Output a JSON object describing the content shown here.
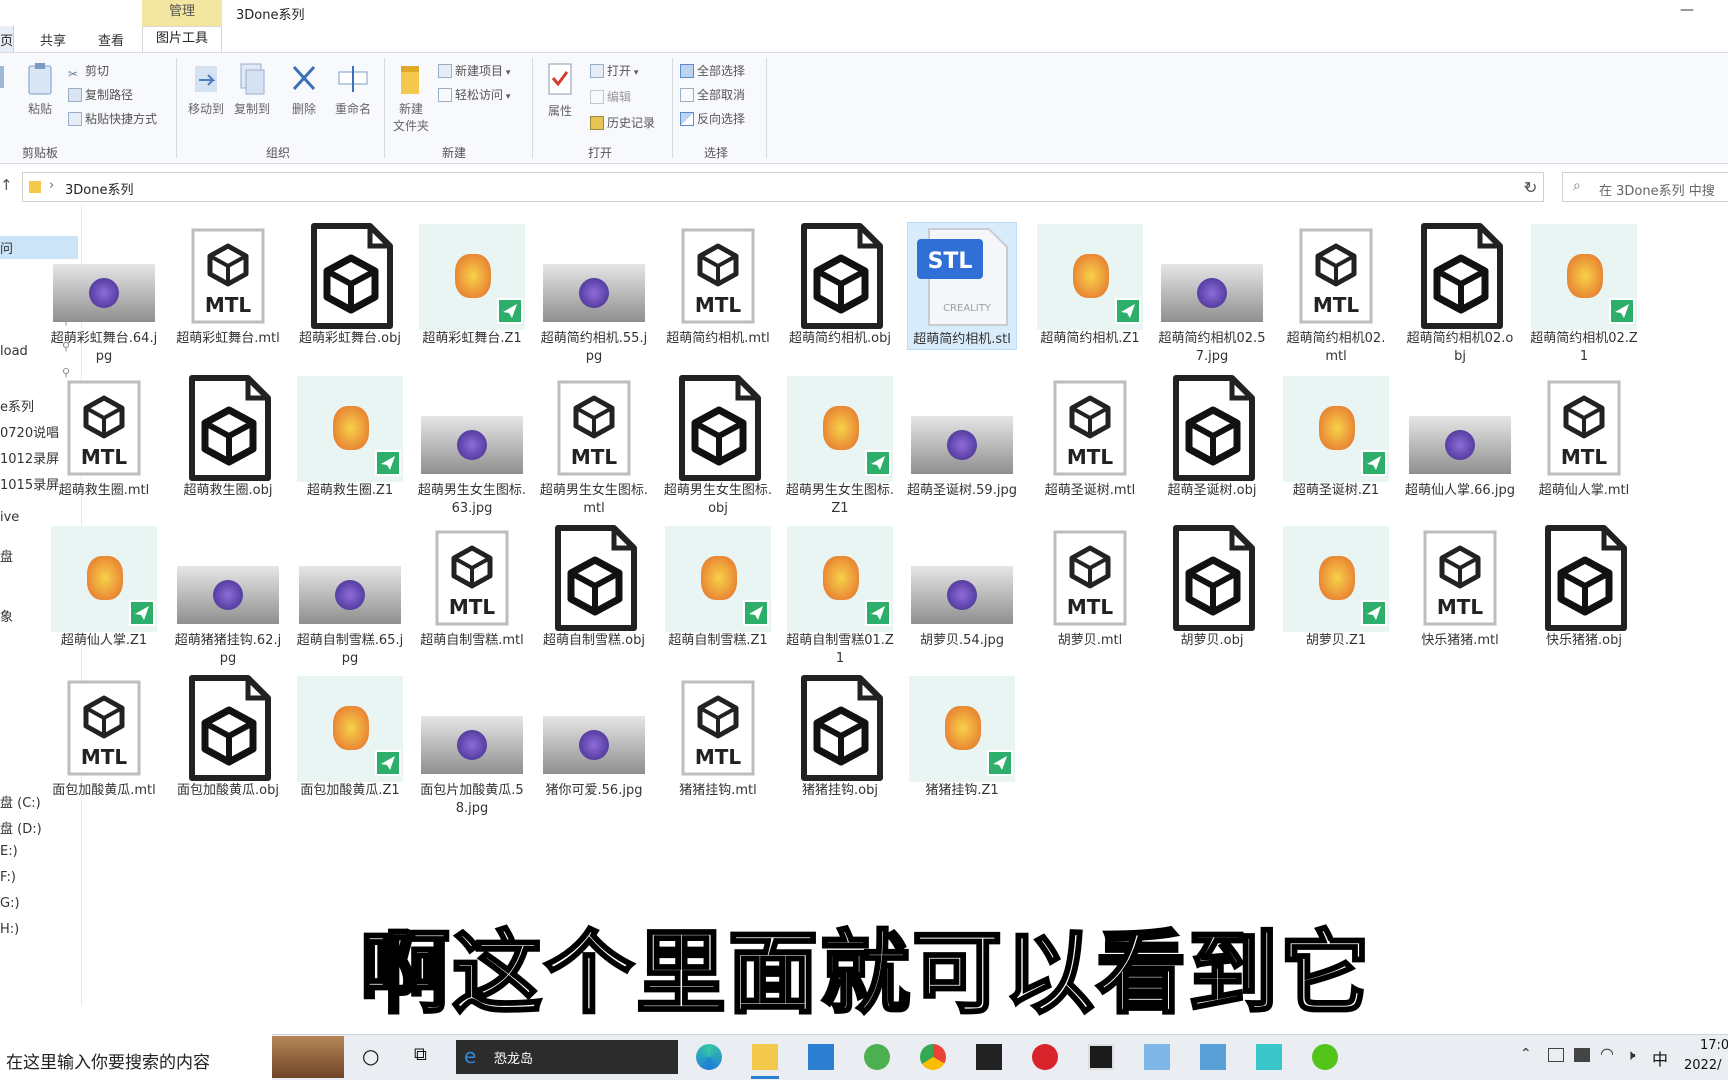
{
  "window": {
    "contextual_tab": "管理",
    "title": "3Done系列",
    "minimize": "—"
  },
  "tabs": [
    "页",
    "共享",
    "查看",
    "图片工具"
  ],
  "ribbon": {
    "clipboard": {
      "label": "剪贴板",
      "paste": "粘贴",
      "cut": "剪切",
      "copy_path": "复制路径",
      "paste_shortcut": "粘贴快捷方式"
    },
    "organize": {
      "label": "组织",
      "move_to": "移动到",
      "copy_to": "复制到",
      "delete": "删除",
      "rename": "重命名"
    },
    "new": {
      "label": "新建",
      "new_folder_line1": "新建",
      "new_folder_line2": "文件夹",
      "new_item": "新建项目",
      "easy_access": "轻松访问"
    },
    "open": {
      "label": "打开",
      "properties": "属性",
      "open": "打开",
      "edit": "编辑",
      "history": "历史记录"
    },
    "select": {
      "label": "选择",
      "select_all": "全部选择",
      "select_none": "全部取消",
      "invert": "反向选择"
    }
  },
  "address": {
    "path": "3Done系列",
    "search_placeholder": "在 3Done系列 中搜"
  },
  "nav": [
    {
      "label": "问",
      "selected": true
    },
    {
      "label": "load"
    },
    {
      "label": "e系列"
    },
    {
      "label": "0720说唱"
    },
    {
      "label": "1012录屏"
    },
    {
      "label": "1015录屏"
    },
    {
      "label": "ive"
    },
    {
      "label": "盘"
    },
    {
      "label": "象"
    },
    {
      "label": "盘 (C:)"
    },
    {
      "label": "盘 (D:)"
    },
    {
      "label": "E:)"
    },
    {
      "label": "F:)"
    },
    {
      "label": "G:)"
    },
    {
      "label": "H:)"
    }
  ],
  "files": [
    {
      "name": "超萌彩虹舞台.64.jpg",
      "kind": "jpg"
    },
    {
      "name": "超萌彩虹舞台.mtl",
      "kind": "mtl"
    },
    {
      "name": "超萌彩虹舞台.obj",
      "kind": "obj"
    },
    {
      "name": "超萌彩虹舞台.Z1",
      "kind": "z1"
    },
    {
      "name": "超萌简约相机.55.jpg",
      "kind": "jpg"
    },
    {
      "name": "超萌简约相机.mtl",
      "kind": "mtl"
    },
    {
      "name": "超萌简约相机.obj",
      "kind": "obj"
    },
    {
      "name": "超萌简约相机.stl",
      "kind": "stl",
      "selected": true
    },
    {
      "name": "超萌简约相机.Z1",
      "kind": "z1"
    },
    {
      "name": "超萌简约相机02.57.jpg",
      "kind": "jpg"
    },
    {
      "name": "超萌简约相机02.mtl",
      "kind": "mtl"
    },
    {
      "name": "超萌简约相机02.obj",
      "kind": "obj"
    },
    {
      "name": "超萌简约相机02.Z1",
      "kind": "z1"
    },
    {
      "name": "超萌救生圈.mtl",
      "kind": "mtl"
    },
    {
      "name": "超萌救生圈.obj",
      "kind": "obj"
    },
    {
      "name": "超萌救生圈.Z1",
      "kind": "z1"
    },
    {
      "name": "超萌男生女生图标.63.jpg",
      "kind": "jpg"
    },
    {
      "name": "超萌男生女生图标.mtl",
      "kind": "mtl"
    },
    {
      "name": "超萌男生女生图标.obj",
      "kind": "obj"
    },
    {
      "name": "超萌男生女生图标.Z1",
      "kind": "z1"
    },
    {
      "name": "超萌圣诞树.59.jpg",
      "kind": "jpg"
    },
    {
      "name": "超萌圣诞树.mtl",
      "kind": "mtl"
    },
    {
      "name": "超萌圣诞树.obj",
      "kind": "obj"
    },
    {
      "name": "超萌圣诞树.Z1",
      "kind": "z1"
    },
    {
      "name": "超萌仙人掌.66.jpg",
      "kind": "jpg"
    },
    {
      "name": "超萌仙人掌.mtl",
      "kind": "mtl"
    },
    {
      "name": "超萌仙人掌.Z1",
      "kind": "z1"
    },
    {
      "name": "超萌猪猪挂钩.62.jpg",
      "kind": "jpg"
    },
    {
      "name": "超萌自制雪糕.65.jpg",
      "kind": "jpg"
    },
    {
      "name": "超萌自制雪糕.mtl",
      "kind": "mtl"
    },
    {
      "name": "超萌自制雪糕.obj",
      "kind": "obj"
    },
    {
      "name": "超萌自制雪糕.Z1",
      "kind": "z1"
    },
    {
      "name": "超萌自制雪糕01.Z1",
      "kind": "z1"
    },
    {
      "name": "胡萝贝.54.jpg",
      "kind": "jpg"
    },
    {
      "name": "胡萝贝.mtl",
      "kind": "mtl"
    },
    {
      "name": "胡萝贝.obj",
      "kind": "obj"
    },
    {
      "name": "胡萝贝.Z1",
      "kind": "z1"
    },
    {
      "name": "快乐猪猪.mtl",
      "kind": "mtl"
    },
    {
      "name": "快乐猪猪.obj",
      "kind": "obj"
    },
    {
      "name": "面包加酸黄瓜.mtl",
      "kind": "mtl"
    },
    {
      "name": "面包加酸黄瓜.obj",
      "kind": "obj"
    },
    {
      "name": "面包加酸黄瓜.Z1",
      "kind": "z1"
    },
    {
      "name": "面包片加酸黄瓜.58.jpg",
      "kind": "jpg"
    },
    {
      "name": "猪你可爱.56.jpg",
      "kind": "jpg"
    },
    {
      "name": "猪猪挂钩.mtl",
      "kind": "mtl"
    },
    {
      "name": "猪猪挂钩.obj",
      "kind": "obj"
    },
    {
      "name": "猪猪挂钩.Z1",
      "kind": "z1"
    }
  ],
  "icon_text": {
    "mtl": "MTL",
    "stl": "STL",
    "stl_brand": "CREALITY"
  },
  "subtitle": "啊这个里面就可以看到它",
  "taskbar": {
    "search_placeholder": "在这里输入你要搜索的内容",
    "dino_label": "恐龙岛",
    "ime": "中",
    "time": "17:0",
    "date": "2022/"
  },
  "colors": {
    "accent": "#2d7fd3",
    "z1_badge": "#2eae6b",
    "stl_badge": "#2f6fd6",
    "ribbon_bg": "#f7f9fc",
    "contextual_tab": "#f2e6a0"
  }
}
